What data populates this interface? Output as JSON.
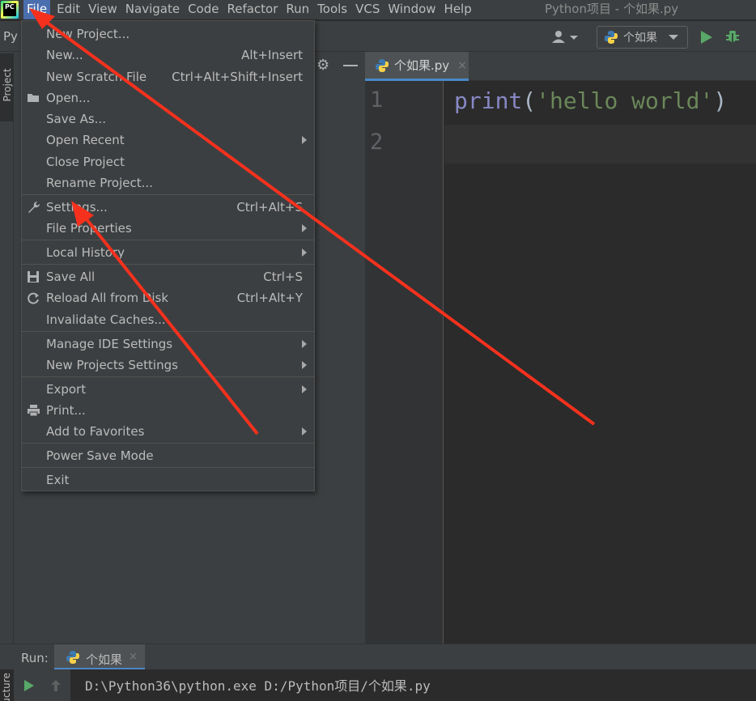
{
  "menubar": {
    "items": [
      {
        "label": "File"
      },
      {
        "label": "Edit"
      },
      {
        "label": "View"
      },
      {
        "label": "Navigate"
      },
      {
        "label": "Code"
      },
      {
        "label": "Refactor"
      },
      {
        "label": "Run"
      },
      {
        "label": "Tools"
      },
      {
        "label": "VCS"
      },
      {
        "label": "Window"
      },
      {
        "label": "Help"
      }
    ],
    "active_item": "File",
    "window_title": "Python项目 - 个如果.py",
    "logo_text": "PC"
  },
  "toolbar": {
    "project_crumb": "Py",
    "run_config": "个如果"
  },
  "left_strip": {
    "project_tab": "Project",
    "structure_tab": "Structure"
  },
  "editor": {
    "tab_label": "个如果.py",
    "tab_close": "×",
    "line_numbers": [
      "1",
      "2"
    ],
    "code": {
      "fn": "print",
      "open_paren": "(",
      "string": "'hello world'",
      "close_paren": ")"
    }
  },
  "file_menu": {
    "items": [
      {
        "label": "New Project...",
        "shortcut": ""
      },
      {
        "label": "New...",
        "shortcut": "Alt+Insert"
      },
      {
        "label": "New Scratch File",
        "shortcut": "Ctrl+Alt+Shift+Insert"
      },
      {
        "label": "Open...",
        "shortcut": ""
      },
      {
        "label": "Save As...",
        "shortcut": ""
      },
      {
        "label": "Open Recent",
        "shortcut": ""
      },
      {
        "label": "Close Project",
        "shortcut": ""
      },
      {
        "label": "Rename Project...",
        "shortcut": ""
      },
      {
        "label": "Settings...",
        "shortcut": "Ctrl+Alt+S"
      },
      {
        "label": "File Properties",
        "shortcut": ""
      },
      {
        "label": "Local History",
        "shortcut": ""
      },
      {
        "label": "Save All",
        "shortcut": "Ctrl+S"
      },
      {
        "label": "Reload All from Disk",
        "shortcut": "Ctrl+Alt+Y"
      },
      {
        "label": "Invalidate Caches...",
        "shortcut": ""
      },
      {
        "label": "Manage IDE Settings",
        "shortcut": ""
      },
      {
        "label": "New Projects Settings",
        "shortcut": ""
      },
      {
        "label": "Export",
        "shortcut": ""
      },
      {
        "label": "Print...",
        "shortcut": ""
      },
      {
        "label": "Add to Favorites",
        "shortcut": ""
      },
      {
        "label": "Power Save Mode",
        "shortcut": ""
      },
      {
        "label": "Exit",
        "shortcut": ""
      }
    ]
  },
  "run_panel": {
    "label": "Run:",
    "tab_label": "个如果",
    "tab_close": "×",
    "console_line": "D:\\Python36\\python.exe D:/Python项目/个如果.py"
  },
  "colors": {
    "accent": "#4b6eaf",
    "arrow": "#f5311d",
    "run_green": "#59a869"
  }
}
